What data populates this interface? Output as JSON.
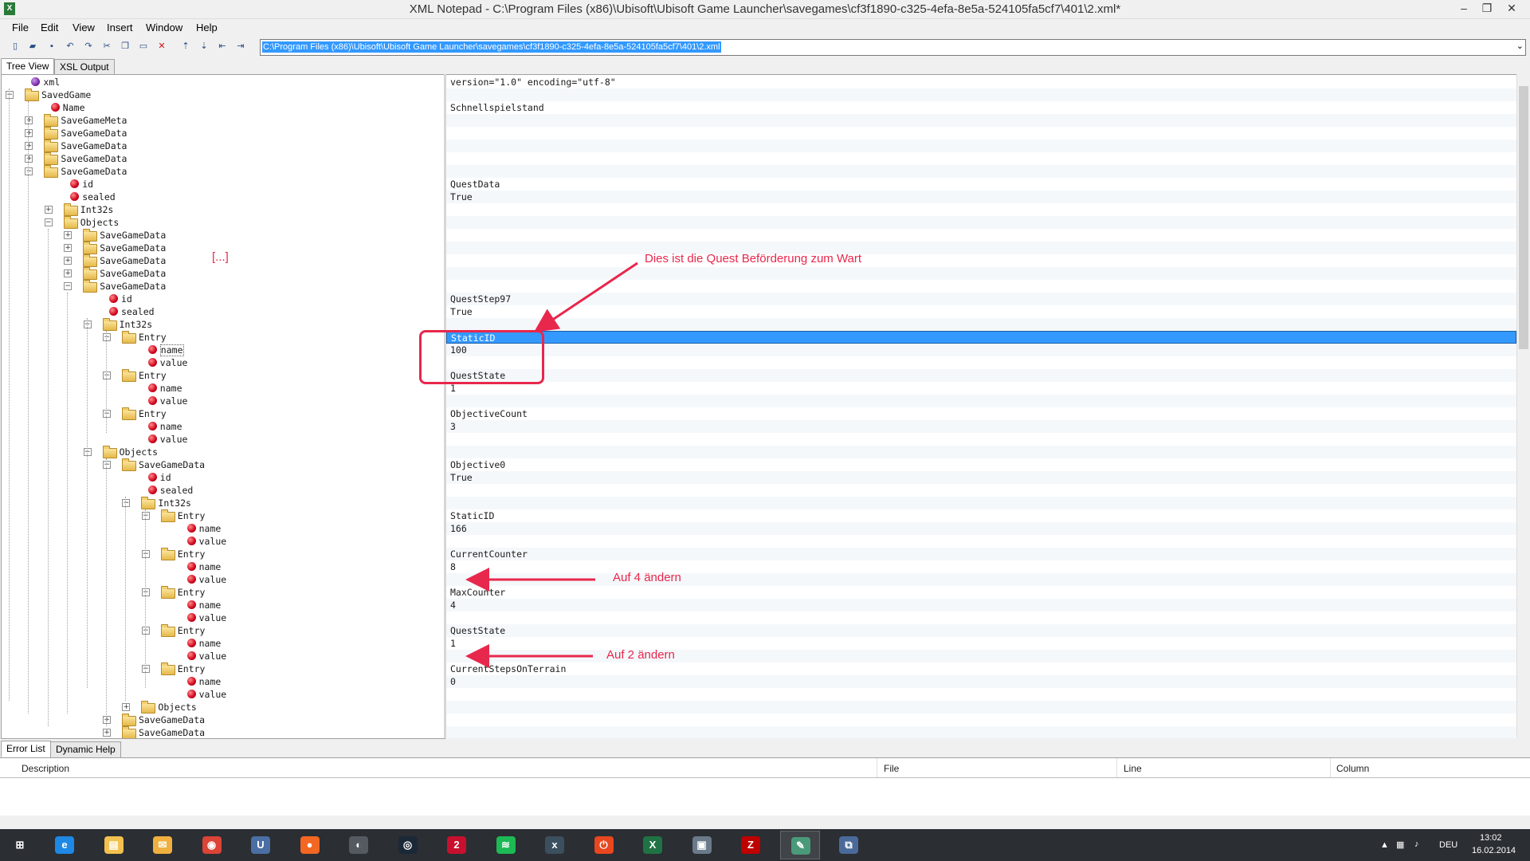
{
  "window": {
    "title": "XML Notepad - C:\\Program Files (x86)\\Ubisoft\\Ubisoft Game Launcher\\savegames\\cf3f1890-c325-4efa-8e5a-524105fa5cf7\\401\\2.xml*",
    "app_icon": "X",
    "minimize": "–",
    "restore": "❐",
    "close": "✕"
  },
  "menu": [
    "File",
    "Edit",
    "View",
    "Insert",
    "Window",
    "Help"
  ],
  "path": {
    "value": "C:\\Program Files (x86)\\Ubisoft\\Ubisoft Game Launcher\\savegames\\cf3f1890-c325-4efa-8e5a-524105fa5cf7\\401\\2.xml",
    "dropdown": "⌄"
  },
  "tabs": {
    "tree_view": "Tree View",
    "xsl_output": "XSL Output"
  },
  "tree": [
    {
      "label": "xml",
      "type": "pi",
      "depth": 1,
      "pm": ""
    },
    {
      "label": "SavedGame",
      "type": "folder",
      "depth": 0,
      "pm": "−"
    },
    {
      "label": "Name",
      "type": "attr",
      "depth": 2,
      "pm": ""
    },
    {
      "label": "SaveGameMeta",
      "type": "folder",
      "depth": 1,
      "pm": "+"
    },
    {
      "label": "SaveGameData",
      "type": "folder",
      "depth": 1,
      "pm": "+"
    },
    {
      "label": "SaveGameData",
      "type": "folder",
      "depth": 1,
      "pm": "+"
    },
    {
      "label": "SaveGameData",
      "type": "folder",
      "depth": 1,
      "pm": "+"
    },
    {
      "label": "SaveGameData",
      "type": "folder",
      "depth": 1,
      "pm": "−"
    },
    {
      "label": "id",
      "type": "attr",
      "depth": 3,
      "pm": ""
    },
    {
      "label": "sealed",
      "type": "attr",
      "depth": 3,
      "pm": ""
    },
    {
      "label": "Int32s",
      "type": "folder",
      "depth": 2,
      "pm": "+"
    },
    {
      "label": "Objects",
      "type": "folder",
      "depth": 2,
      "pm": "−"
    },
    {
      "label": "SaveGameData",
      "type": "folder",
      "depth": 3,
      "pm": "+"
    },
    {
      "label": "SaveGameData",
      "type": "folder",
      "depth": 3,
      "pm": "+"
    },
    {
      "label": "SaveGameData",
      "type": "folder",
      "depth": 3,
      "pm": "+"
    },
    {
      "label": "SaveGameData",
      "type": "folder",
      "depth": 3,
      "pm": "+"
    },
    {
      "label": "SaveGameData",
      "type": "folder",
      "depth": 3,
      "pm": "−"
    },
    {
      "label": "id",
      "type": "attr",
      "depth": 5,
      "pm": ""
    },
    {
      "label": "sealed",
      "type": "attr",
      "depth": 5,
      "pm": ""
    },
    {
      "label": "Int32s",
      "type": "folder",
      "depth": 4,
      "pm": "−"
    },
    {
      "label": "Entry",
      "type": "folder",
      "depth": 5,
      "pm": "−"
    },
    {
      "label": "name",
      "type": "attr",
      "depth": 7,
      "pm": "",
      "focused": true
    },
    {
      "label": "value",
      "type": "attr",
      "depth": 7,
      "pm": ""
    },
    {
      "label": "Entry",
      "type": "folder",
      "depth": 5,
      "pm": "−"
    },
    {
      "label": "name",
      "type": "attr",
      "depth": 7,
      "pm": ""
    },
    {
      "label": "value",
      "type": "attr",
      "depth": 7,
      "pm": ""
    },
    {
      "label": "Entry",
      "type": "folder",
      "depth": 5,
      "pm": "−"
    },
    {
      "label": "name",
      "type": "attr",
      "depth": 7,
      "pm": ""
    },
    {
      "label": "value",
      "type": "attr",
      "depth": 7,
      "pm": ""
    },
    {
      "label": "Objects",
      "type": "folder",
      "depth": 4,
      "pm": "−"
    },
    {
      "label": "SaveGameData",
      "type": "folder",
      "depth": 5,
      "pm": "−"
    },
    {
      "label": "id",
      "type": "attr",
      "depth": 7,
      "pm": ""
    },
    {
      "label": "sealed",
      "type": "attr",
      "depth": 7,
      "pm": ""
    },
    {
      "label": "Int32s",
      "type": "folder",
      "depth": 6,
      "pm": "−"
    },
    {
      "label": "Entry",
      "type": "folder",
      "depth": 7,
      "pm": "−"
    },
    {
      "label": "name",
      "type": "attr",
      "depth": 9,
      "pm": ""
    },
    {
      "label": "value",
      "type": "attr",
      "depth": 9,
      "pm": ""
    },
    {
      "label": "Entry",
      "type": "folder",
      "depth": 7,
      "pm": "−"
    },
    {
      "label": "name",
      "type": "attr",
      "depth": 9,
      "pm": ""
    },
    {
      "label": "value",
      "type": "attr",
      "depth": 9,
      "pm": ""
    },
    {
      "label": "Entry",
      "type": "folder",
      "depth": 7,
      "pm": "−"
    },
    {
      "label": "name",
      "type": "attr",
      "depth": 9,
      "pm": ""
    },
    {
      "label": "value",
      "type": "attr",
      "depth": 9,
      "pm": ""
    },
    {
      "label": "Entry",
      "type": "folder",
      "depth": 7,
      "pm": "−"
    },
    {
      "label": "name",
      "type": "attr",
      "depth": 9,
      "pm": ""
    },
    {
      "label": "value",
      "type": "attr",
      "depth": 9,
      "pm": ""
    },
    {
      "label": "Entry",
      "type": "folder",
      "depth": 7,
      "pm": "−"
    },
    {
      "label": "name",
      "type": "attr",
      "depth": 9,
      "pm": ""
    },
    {
      "label": "value",
      "type": "attr",
      "depth": 9,
      "pm": ""
    },
    {
      "label": "Objects",
      "type": "folder",
      "depth": 6,
      "pm": "+"
    },
    {
      "label": "SaveGameData",
      "type": "folder",
      "depth": 5,
      "pm": "+"
    },
    {
      "label": "SaveGameData",
      "type": "folder",
      "depth": 5,
      "pm": "+"
    }
  ],
  "values": [
    "version=\"1.0\" encoding=\"utf-8\"",
    "",
    "Schnellspielstand",
    "",
    "",
    "",
    "",
    "",
    "QuestData",
    "True",
    "",
    "",
    "",
    "",
    "",
    "",
    "",
    "QuestStep97",
    "True",
    "",
    "StaticID",
    "100",
    "",
    "QuestState",
    "1",
    "",
    "ObjectiveCount",
    "3",
    "",
    "",
    "Objective0",
    "True",
    "",
    "",
    "StaticID",
    "166",
    "",
    "CurrentCounter",
    "8",
    "",
    "MaxCounter",
    "4",
    "",
    "QuestState",
    "1",
    "",
    "CurrentStepsOnTerrain",
    "0",
    "",
    "",
    "",
    ""
  ],
  "selected_value_row": 20,
  "annotations": {
    "ellipsis": "[...]",
    "quest": "Dies ist die Quest Beförderung zum Wart",
    "counter": "Auf 4 ändern",
    "state": "Auf 2 ändern",
    "color": "#e8274c"
  },
  "bottom_tabs": {
    "error_list": "Error List",
    "dynamic_help": "Dynamic Help"
  },
  "error_columns": [
    "Description",
    "File",
    "Line",
    "Column"
  ],
  "taskbar": {
    "apps": [
      {
        "name": "start-icon",
        "glyph": "⊞",
        "color": "#2b2e33",
        "open": false
      },
      {
        "name": "internet-explorer-icon",
        "glyph": "e",
        "color": "#1e88e5",
        "open": false
      },
      {
        "name": "file-explorer-icon",
        "glyph": "▤",
        "color": "#f2c14e",
        "open": false
      },
      {
        "name": "mail-icon",
        "glyph": "✉",
        "color": "#f0b040",
        "open": false
      },
      {
        "name": "chrome-icon",
        "glyph": "◉",
        "color": "#db4437",
        "open": false
      },
      {
        "name": "uplay-icon",
        "glyph": "U",
        "color": "#4a6fa5",
        "open": false
      },
      {
        "name": "origin-icon",
        "glyph": "●",
        "color": "#f26722",
        "open": false
      },
      {
        "name": "mumble-icon",
        "glyph": "◐",
        "color": "#555a60",
        "open": false
      },
      {
        "name": "steam-icon",
        "glyph": "◎",
        "color": "#1b2838",
        "open": false
      },
      {
        "name": "gw2-icon",
        "glyph": "2",
        "color": "#c8102e",
        "open": false
      },
      {
        "name": "spotify-icon",
        "glyph": "≋",
        "color": "#1db954",
        "open": false
      },
      {
        "name": "xbmc-icon",
        "glyph": "x",
        "color": "#3b4f5e",
        "open": false
      },
      {
        "name": "power-icon",
        "glyph": "⏻",
        "color": "#e8471f",
        "open": false
      },
      {
        "name": "excel-icon",
        "glyph": "X",
        "color": "#1f7244",
        "open": false
      },
      {
        "name": "window-icon",
        "glyph": "▣",
        "color": "#6b7a8a",
        "open": false
      },
      {
        "name": "filezilla-icon",
        "glyph": "Z",
        "color": "#bf0000",
        "open": false
      },
      {
        "name": "xml-notepad-icon",
        "glyph": "✎",
        "color": "#4a9a7a",
        "open": true
      },
      {
        "name": "remote-icon",
        "glyph": "⧉",
        "color": "#4a6a9a",
        "open": false
      }
    ],
    "tray_arrow": "▲",
    "language": "DEU",
    "time": "13:02",
    "date": "16.02.2014"
  }
}
